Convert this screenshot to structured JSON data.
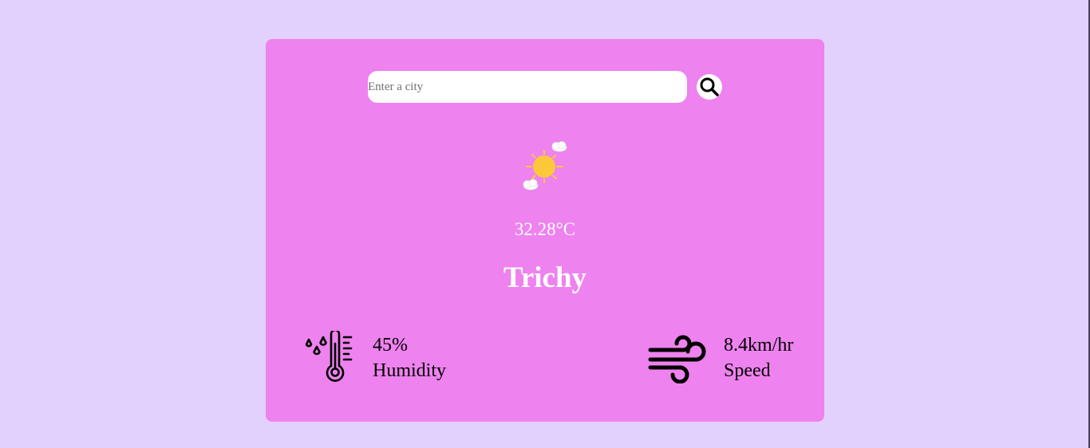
{
  "search": {
    "placeholder": "Enter a city",
    "value": "",
    "button_icon": "search-icon"
  },
  "weather": {
    "icon": "sun-with-clouds-icon",
    "temperature": "32.28°C",
    "city": "Trichy"
  },
  "humidity": {
    "icon": "humidity-thermometer-icon",
    "value": "45%",
    "label": "Humidity"
  },
  "wind": {
    "icon": "wind-icon",
    "value": "8.4km/hr",
    "label": "Speed"
  },
  "colors": {
    "page_background": "#e2d1fd",
    "card_background": "#ee82ee",
    "sun": "#fcc83a",
    "text_light": "#ffffff",
    "text_dark": "#000000"
  }
}
